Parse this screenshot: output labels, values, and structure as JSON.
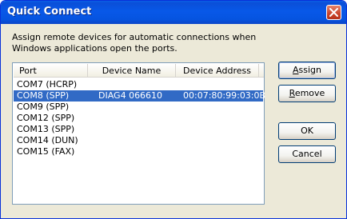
{
  "window": {
    "title": "Quick Connect",
    "close_icon": "close-icon"
  },
  "description": "Assign remote devices for automatic connections when Windows applications open the ports.",
  "list": {
    "columns": [
      "Port",
      "Device Name",
      "Device Address"
    ],
    "rows": [
      {
        "port": "COM7 (HCRP)",
        "name": "",
        "address": "",
        "selected": false
      },
      {
        "port": "COM8 (SPP)",
        "name": "DIAG4 066610",
        "address": "00:07:80:99:03:0B",
        "selected": true
      },
      {
        "port": "COM9 (SPP)",
        "name": "",
        "address": "",
        "selected": false
      },
      {
        "port": "COM12 (SPP)",
        "name": "",
        "address": "",
        "selected": false
      },
      {
        "port": "COM13 (SPP)",
        "name": "",
        "address": "",
        "selected": false
      },
      {
        "port": "COM14 (DUN)",
        "name": "",
        "address": "",
        "selected": false
      },
      {
        "port": "COM15 (FAX)",
        "name": "",
        "address": "",
        "selected": false
      }
    ]
  },
  "buttons": {
    "assign": {
      "accel": "A",
      "rest": "ssign"
    },
    "remove": {
      "accel": "R",
      "rest": "emove"
    },
    "ok": "OK",
    "cancel": "Cancel"
  },
  "colors": {
    "titlebar": "#0858e8",
    "selection": "#316ac5",
    "dialog_bg": "#ece9d8"
  }
}
